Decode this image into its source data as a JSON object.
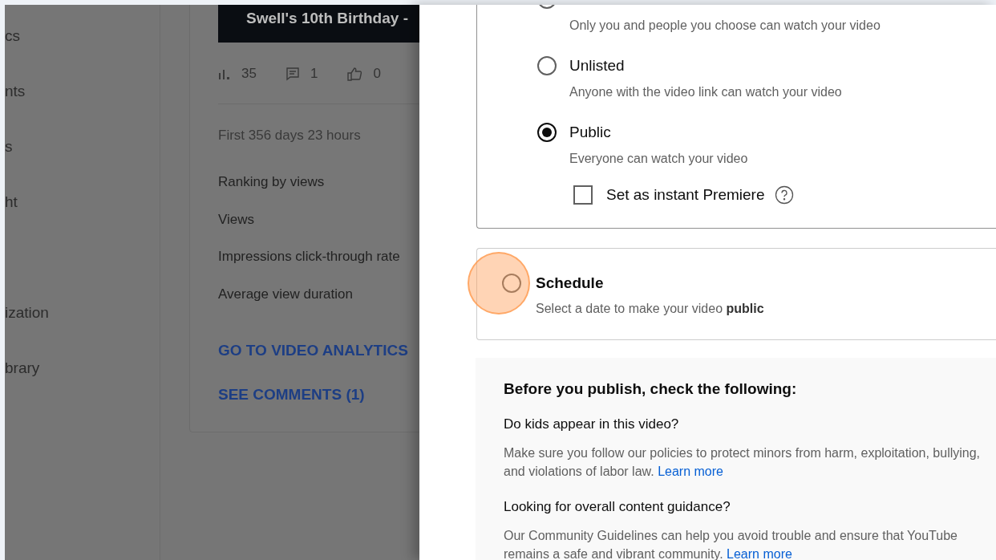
{
  "sidebar": {
    "groups": [
      [
        "cs",
        "nts",
        "s",
        "ht"
      ],
      [
        "ization",
        "brary"
      ]
    ]
  },
  "video_card": {
    "title": "Swell's 10th Birthday -",
    "stats": [
      {
        "kind": "views",
        "value": "35"
      },
      {
        "kind": "comments",
        "value": "1"
      },
      {
        "kind": "likes",
        "value": "0"
      }
    ],
    "period": "First 356 days 23 hours",
    "metrics": [
      "Ranking by views",
      "Views",
      "Impressions click-through rate",
      "Average view duration"
    ],
    "links": [
      "GO TO VIDEO ANALYTICS",
      "SEE COMMENTS (1)"
    ]
  },
  "visibility": {
    "options": [
      {
        "description": "Only you and people you choose can watch your video",
        "selected": false
      },
      {
        "label": "Unlisted",
        "description": "Anyone with the video link can watch your video",
        "selected": false
      },
      {
        "label": "Public",
        "description": "Everyone can watch your video",
        "selected": true
      }
    ],
    "premiere": {
      "label": "Set as instant Premiere",
      "checked": false
    }
  },
  "schedule": {
    "label": "Schedule",
    "description": "Select a date to make your video **public**",
    "selected": false
  },
  "checklist": {
    "heading": "Before you publish, check the following:",
    "sections": [
      {
        "title": "Do kids appear in this video?",
        "text": "Make sure you follow our policies to protect minors from harm, exploitation, bullying, and violations of labor law.",
        "link": "Learn more"
      },
      {
        "title": "Looking for overall content guidance?",
        "text": "Our Community Guidelines can help you avoid trouble and ensure that YouTube remains a safe and vibrant community.",
        "link": "Learn more"
      }
    ]
  }
}
